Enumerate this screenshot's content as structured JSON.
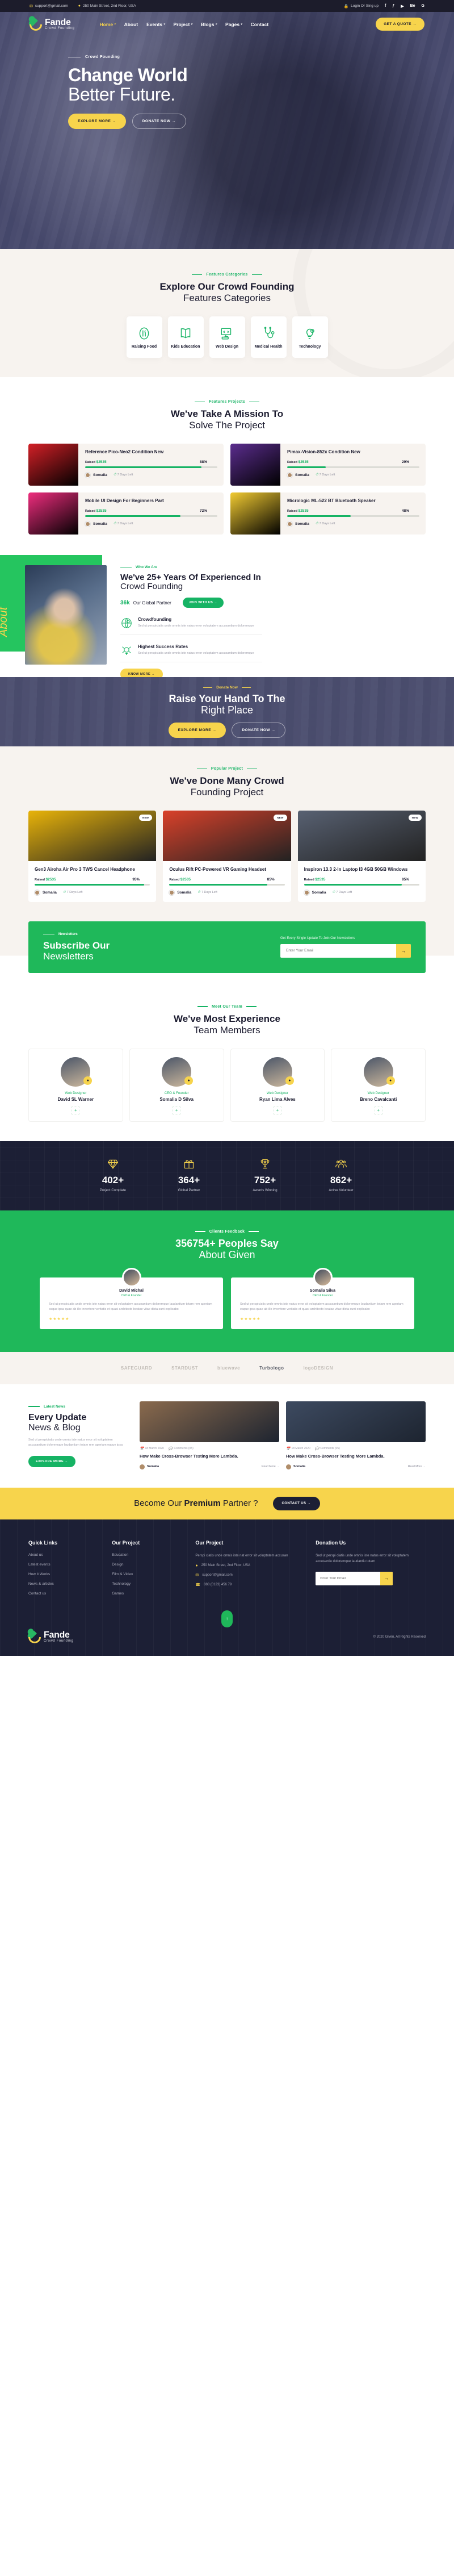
{
  "topbar": {
    "email": "support@gmail.com",
    "address": "250 Main Street, 2nd Floor, USA",
    "login": "Login Or Sing up",
    "social": [
      "f",
      "ƒ",
      "▶",
      "Be",
      "G"
    ]
  },
  "nav": {
    "brand": "Fande",
    "tagline": "Crowd Founding",
    "items": [
      {
        "label": "Home",
        "caret": "▾",
        "active": true
      },
      {
        "label": "About",
        "caret": "",
        "active": false
      },
      {
        "label": "Events",
        "caret": "▾",
        "active": false
      },
      {
        "label": "Project",
        "caret": "▾",
        "active": false
      },
      {
        "label": "Blogs",
        "caret": "▾",
        "active": false
      },
      {
        "label": "Pages",
        "caret": "▾",
        "active": false
      },
      {
        "label": "Contact",
        "caret": "",
        "active": false
      }
    ],
    "quote_button": "GET A QUOTE  →"
  },
  "hero": {
    "eyebrow": "Crowd Founding",
    "title_bold": "Change World",
    "title_thin": "Better Future.",
    "primary_btn": "EXPLORE MORE  →",
    "secondary_btn": "DONATE NOW  →"
  },
  "features": {
    "tag": "Features Categories",
    "title_bold": "Explore Our Crowd Founding",
    "title_thin": "Features Categories",
    "cards": [
      {
        "label": "Raising Food",
        "icon": "food-icon"
      },
      {
        "label": "Kids Education",
        "icon": "book-icon"
      },
      {
        "label": "Web Design",
        "icon": "monitor-code-icon"
      },
      {
        "label": "Medical Health",
        "icon": "stethoscope-icon"
      },
      {
        "label": "Technology",
        "icon": "bulb-gear-icon"
      }
    ]
  },
  "projects": {
    "tag": "Features Projects",
    "title_bold": "We've Take A Mission To",
    "title_thin": "Solve The Project",
    "raised_label": "Raised",
    "author": "Somalia",
    "days": "7 Days Left",
    "items": [
      {
        "title": "Reference Pico-Neo2 Condition New",
        "amount": "$2535",
        "pct": "88%",
        "pctnum": 88,
        "img": "#d32027"
      },
      {
        "title": "Pimax-Vision-852x Condition New",
        "amount": "$2535",
        "pct": "29%",
        "pctnum": 29,
        "img": "#5b2d8e"
      },
      {
        "title": "Mobile UI Design For Beginners Part",
        "amount": "$2535",
        "pct": "72%",
        "pctnum": 72,
        "img": "#ef2d7e"
      },
      {
        "title": "Micrologic ML-522 BT Bluetooth Speaker",
        "amount": "$2535",
        "pct": "48%",
        "pctnum": 48,
        "img": "#f2cb32"
      }
    ]
  },
  "about": {
    "script_text": "About",
    "tag": "Who We Are",
    "title_bold": "We've 25+ Years Of Experienced In",
    "title_thin": "Crowd Founding",
    "partner_num": "36k",
    "partner_label": "Our Global Partner",
    "join_btn": "JOIN WITH US  →",
    "features": [
      {
        "icon": "globe-dollar-icon",
        "title": "Crowdfounding",
        "desc": "Sed ut perspiciatis unde omnis iste natus error voluptatem accusantium doloremque"
      },
      {
        "icon": "bulb-growth-icon",
        "title": "Highest Success Rates",
        "desc": "Sed ut perspiciatis unde omnis iste natus error voluptatem accusantium doloremque"
      }
    ],
    "more_btn": "KNOW MORE  →"
  },
  "raise": {
    "tag": "Donate Now",
    "title_bold": "Raise Your Hand To The",
    "title_thin": "Right Place",
    "primary_btn": "EXPLORE MORE  →",
    "secondary_btn": "DONATE NOW  →"
  },
  "done": {
    "tag": "Popular Project",
    "title_bold": "We've Done Many Crowd",
    "title_thin": "Founding Project",
    "badge": "NEW",
    "raised_label": "Raised",
    "author": "Somalia",
    "days": "7 Days Left",
    "items": [
      {
        "title": "Gen3 Airoha Air Pro 3 TWS Cancel Headphone",
        "amount": "$2535",
        "pct": "95%",
        "pctnum": 95,
        "img": "#e8b309"
      },
      {
        "title": "Oculus Rift PC-Powered VR Gaming Headset",
        "amount": "$2535",
        "pct": "85%",
        "pctnum": 85,
        "img": "#d9412a"
      },
      {
        "title": "Inspiron 13.3 2-In Laptop I3 4GB 50GB Windows",
        "amount": "$2535",
        "pct": "85%",
        "pctnum": 85,
        "img": "#586172"
      }
    ]
  },
  "newsletter": {
    "tag": "Newsletters",
    "title_bold": "Subscribe Our",
    "title_thin": "Newsletters",
    "note": "Get Every Single Update To Join Our Newsletters",
    "placeholder": "Enter Your Email",
    "value": "",
    "submit_icon": "→"
  },
  "team": {
    "tag": "Meet Our Team",
    "title_bold": "We've Most Experience",
    "title_thin": "Team Members",
    "members": [
      {
        "role": "Web Designer",
        "name": "David SL Warner"
      },
      {
        "role": "CEO & Founder",
        "name": "Somalia D Silva"
      },
      {
        "role": "Web Designer",
        "name": "Ryan Lima Alves"
      },
      {
        "role": "Web Designer",
        "name": "Breno Cavalcanti"
      }
    ],
    "plus": "+"
  },
  "counters": [
    {
      "icon": "diamond-icon",
      "num": "402+",
      "label": "Project Complate"
    },
    {
      "icon": "gift-icon",
      "num": "364+",
      "label": "Global Partner"
    },
    {
      "icon": "trophy-icon",
      "num": "752+",
      "label": "Awards Winning"
    },
    {
      "icon": "users-icon",
      "num": "862+",
      "label": "Active Volunteer"
    }
  ],
  "testimonials": {
    "tag": "Clients Feedback",
    "title_bold": "356754+ Peoples Say",
    "title_thin": "About Given",
    "stars": "★★★★★",
    "items": [
      {
        "name": "David Michal",
        "role": "CEO & Founder",
        "text": "Sed ut perspiciatis unde omnis iste natus error sit voluptatem accusantium doloremque laudantium totam rem aperiam eaque ipsa quae ab illo inventore veritatis et quasi architecto beatae vitae dicta sunt explicabo"
      },
      {
        "name": "Somalia Silva",
        "role": "CEO & Founder",
        "text": "Sed ut perspiciatis unde omnis iste natus error sit voluptatem accusantium doloremque laudantium totam rem aperiam eaque ipsa quae ab illo inventore veritatis et quasi architecto beatae vitae dicta sunt explicabo"
      }
    ]
  },
  "brands": [
    "SAFEGUARD",
    "STARDUST",
    "bluewave",
    "Turbologo",
    "logoDESIGN"
  ],
  "blog": {
    "tag": "Latest News",
    "title_bold": "Every Update",
    "title_thin": "News & Blog",
    "desc": "Sed ut perspiciatis unde omnis iste natus error sit voluptatem accusantium doloremque laudantium totam rem aperiam eaque ipsa",
    "more_btn": "EXPLORE MORE  →",
    "posts": [
      {
        "date": "18 March 2020",
        "comments": "Comments (05)",
        "title": "How Make Cross-Browser Testing More Lambda.",
        "author": "Somalia",
        "read": "Read More →",
        "img": "#8a6a4d"
      },
      {
        "date": "18 March 2020",
        "comments": "Comments (05)",
        "title": "How Make Cross-Browser Testing More Lambda.",
        "author": "Somalia",
        "read": "Read More →",
        "img": "#3d4a60"
      }
    ]
  },
  "premium": {
    "title_thin": "Become Our",
    "title_bold": "Premium",
    "title_tail": "Partner ?",
    "btn": "CONTACT US  →"
  },
  "footer": {
    "columns": [
      {
        "title": "Quick Links",
        "links": [
          "About us",
          "Latest events",
          "How it Works",
          "News & articles",
          "Contact us"
        ]
      },
      {
        "title": "Our Project",
        "links": [
          "Education",
          "Design",
          "Film & Video",
          "Technology",
          "Games"
        ]
      }
    ],
    "contact": {
      "title": "Our Project",
      "desc": "Perspi ciatis unde omnis iste nat error sit voluptatem accusan",
      "address": "250 Main Street, 2nd Floor, USA",
      "email": "support@gmail.com",
      "phone": "888 (0123) 456 79"
    },
    "donation": {
      "title": "Donation Us",
      "desc": "Sed ut perspi ciatis unde omnis iste natus error sit voluptatem accusantiu doloremque laudantiu totam",
      "placeholder": "Enter Your Email",
      "value": "",
      "submit_icon": "→"
    },
    "brand": "Fande",
    "tagline": "Crowd Founding",
    "copyright": "© 2020 Given, All Rights Reserved",
    "gotop": "↑"
  }
}
